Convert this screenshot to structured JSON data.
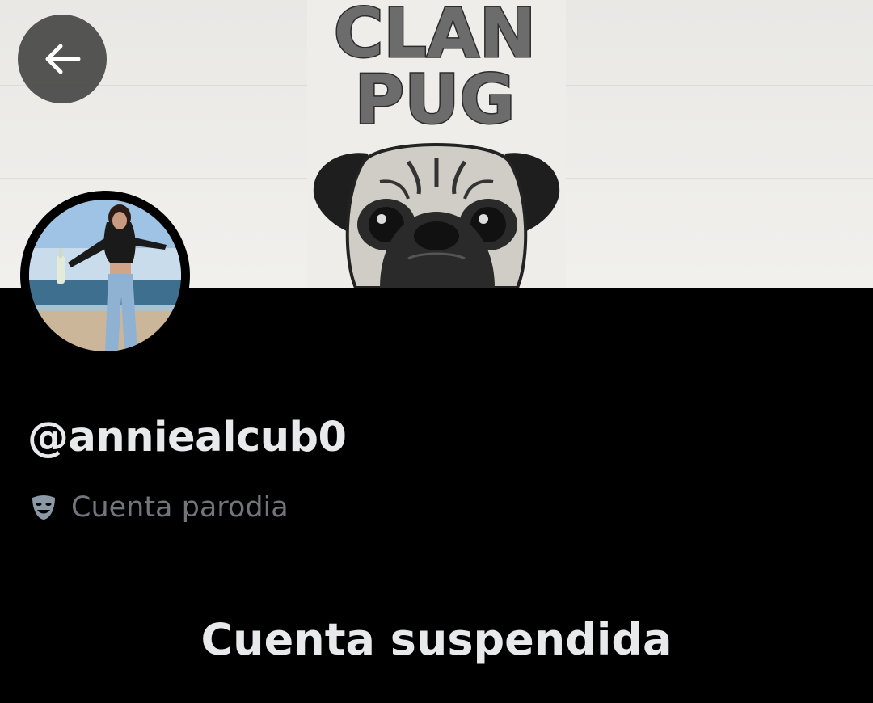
{
  "banner": {
    "line1": "CLAN",
    "line2": "PUG",
    "background_color": "#ecebe8"
  },
  "back_button": {
    "icon": "arrow-left-icon"
  },
  "profile": {
    "avatar_icon": "profile-photo",
    "handle": "@anniealcub0",
    "parody_icon": "theater-masks-icon",
    "parody_label": "Cuenta parodia"
  },
  "status": {
    "message": "Cuenta suspendida"
  },
  "colors": {
    "background": "#000000",
    "primary_text": "#e7e9ea",
    "secondary_text": "#71767b"
  }
}
